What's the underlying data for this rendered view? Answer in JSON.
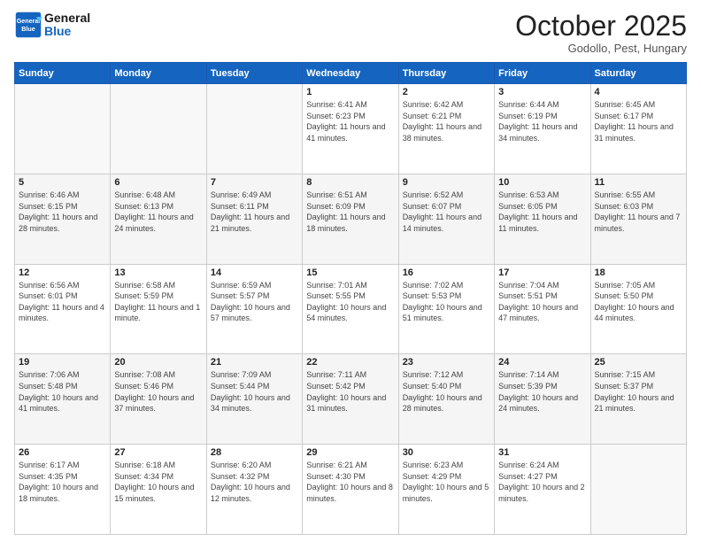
{
  "header": {
    "logo_line1": "General",
    "logo_line2": "Blue",
    "month": "October 2025",
    "location": "Godollo, Pest, Hungary"
  },
  "weekdays": [
    "Sunday",
    "Monday",
    "Tuesday",
    "Wednesday",
    "Thursday",
    "Friday",
    "Saturday"
  ],
  "weeks": [
    [
      {
        "day": "",
        "info": ""
      },
      {
        "day": "",
        "info": ""
      },
      {
        "day": "",
        "info": ""
      },
      {
        "day": "1",
        "info": "Sunrise: 6:41 AM\nSunset: 6:23 PM\nDaylight: 11 hours and 41 minutes."
      },
      {
        "day": "2",
        "info": "Sunrise: 6:42 AM\nSunset: 6:21 PM\nDaylight: 11 hours and 38 minutes."
      },
      {
        "day": "3",
        "info": "Sunrise: 6:44 AM\nSunset: 6:19 PM\nDaylight: 11 hours and 34 minutes."
      },
      {
        "day": "4",
        "info": "Sunrise: 6:45 AM\nSunset: 6:17 PM\nDaylight: 11 hours and 31 minutes."
      }
    ],
    [
      {
        "day": "5",
        "info": "Sunrise: 6:46 AM\nSunset: 6:15 PM\nDaylight: 11 hours and 28 minutes."
      },
      {
        "day": "6",
        "info": "Sunrise: 6:48 AM\nSunset: 6:13 PM\nDaylight: 11 hours and 24 minutes."
      },
      {
        "day": "7",
        "info": "Sunrise: 6:49 AM\nSunset: 6:11 PM\nDaylight: 11 hours and 21 minutes."
      },
      {
        "day": "8",
        "info": "Sunrise: 6:51 AM\nSunset: 6:09 PM\nDaylight: 11 hours and 18 minutes."
      },
      {
        "day": "9",
        "info": "Sunrise: 6:52 AM\nSunset: 6:07 PM\nDaylight: 11 hours and 14 minutes."
      },
      {
        "day": "10",
        "info": "Sunrise: 6:53 AM\nSunset: 6:05 PM\nDaylight: 11 hours and 11 minutes."
      },
      {
        "day": "11",
        "info": "Sunrise: 6:55 AM\nSunset: 6:03 PM\nDaylight: 11 hours and 7 minutes."
      }
    ],
    [
      {
        "day": "12",
        "info": "Sunrise: 6:56 AM\nSunset: 6:01 PM\nDaylight: 11 hours and 4 minutes."
      },
      {
        "day": "13",
        "info": "Sunrise: 6:58 AM\nSunset: 5:59 PM\nDaylight: 11 hours and 1 minute."
      },
      {
        "day": "14",
        "info": "Sunrise: 6:59 AM\nSunset: 5:57 PM\nDaylight: 10 hours and 57 minutes."
      },
      {
        "day": "15",
        "info": "Sunrise: 7:01 AM\nSunset: 5:55 PM\nDaylight: 10 hours and 54 minutes."
      },
      {
        "day": "16",
        "info": "Sunrise: 7:02 AM\nSunset: 5:53 PM\nDaylight: 10 hours and 51 minutes."
      },
      {
        "day": "17",
        "info": "Sunrise: 7:04 AM\nSunset: 5:51 PM\nDaylight: 10 hours and 47 minutes."
      },
      {
        "day": "18",
        "info": "Sunrise: 7:05 AM\nSunset: 5:50 PM\nDaylight: 10 hours and 44 minutes."
      }
    ],
    [
      {
        "day": "19",
        "info": "Sunrise: 7:06 AM\nSunset: 5:48 PM\nDaylight: 10 hours and 41 minutes."
      },
      {
        "day": "20",
        "info": "Sunrise: 7:08 AM\nSunset: 5:46 PM\nDaylight: 10 hours and 37 minutes."
      },
      {
        "day": "21",
        "info": "Sunrise: 7:09 AM\nSunset: 5:44 PM\nDaylight: 10 hours and 34 minutes."
      },
      {
        "day": "22",
        "info": "Sunrise: 7:11 AM\nSunset: 5:42 PM\nDaylight: 10 hours and 31 minutes."
      },
      {
        "day": "23",
        "info": "Sunrise: 7:12 AM\nSunset: 5:40 PM\nDaylight: 10 hours and 28 minutes."
      },
      {
        "day": "24",
        "info": "Sunrise: 7:14 AM\nSunset: 5:39 PM\nDaylight: 10 hours and 24 minutes."
      },
      {
        "day": "25",
        "info": "Sunrise: 7:15 AM\nSunset: 5:37 PM\nDaylight: 10 hours and 21 minutes."
      }
    ],
    [
      {
        "day": "26",
        "info": "Sunrise: 6:17 AM\nSunset: 4:35 PM\nDaylight: 10 hours and 18 minutes."
      },
      {
        "day": "27",
        "info": "Sunrise: 6:18 AM\nSunset: 4:34 PM\nDaylight: 10 hours and 15 minutes."
      },
      {
        "day": "28",
        "info": "Sunrise: 6:20 AM\nSunset: 4:32 PM\nDaylight: 10 hours and 12 minutes."
      },
      {
        "day": "29",
        "info": "Sunrise: 6:21 AM\nSunset: 4:30 PM\nDaylight: 10 hours and 8 minutes."
      },
      {
        "day": "30",
        "info": "Sunrise: 6:23 AM\nSunset: 4:29 PM\nDaylight: 10 hours and 5 minutes."
      },
      {
        "day": "31",
        "info": "Sunrise: 6:24 AM\nSunset: 4:27 PM\nDaylight: 10 hours and 2 minutes."
      },
      {
        "day": "",
        "info": ""
      }
    ]
  ]
}
